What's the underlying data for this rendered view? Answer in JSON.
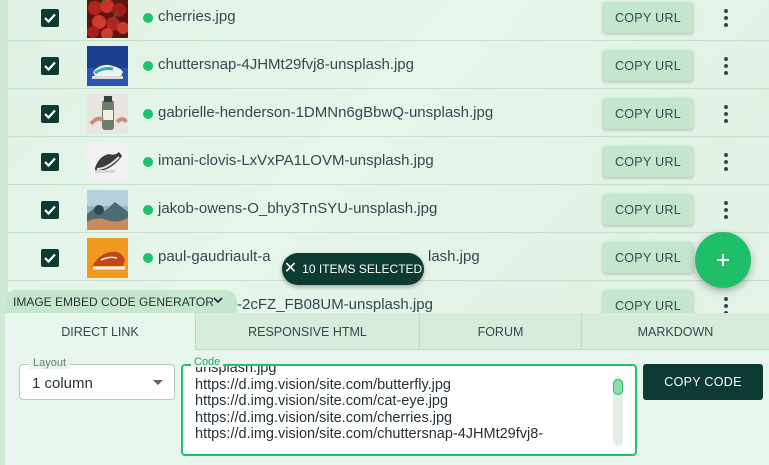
{
  "rows": [
    {
      "filename": "cherries.jpg",
      "checked": true,
      "thumbnail": "cherries-thumbnail",
      "copy_label": "COPY URL"
    },
    {
      "filename": "chuttersnap-4JHMt29fvj8-unsplash.jpg",
      "checked": true,
      "thumbnail": "sneaker-blue-thumbnail",
      "copy_label": "COPY URL"
    },
    {
      "filename": "gabrielle-henderson-1DMNn6gBbwQ-unsplash.jpg",
      "checked": true,
      "thumbnail": "bottle-thumbnail",
      "copy_label": "COPY URL"
    },
    {
      "filename": "imani-clovis-LxVxPA1LOVM-unsplash.jpg",
      "checked": true,
      "thumbnail": "sneaker-white-thumbnail",
      "copy_label": "COPY URL"
    },
    {
      "filename": "jakob-owens-O_bhy3TnSYU-unsplash.jpg",
      "checked": true,
      "thumbnail": "landscape-thumbnail",
      "copy_label": "COPY URL"
    },
    {
      "filename": "paul-gaudriault-a",
      "filename_tail": "lash.jpg",
      "checked": true,
      "thumbnail": "orange-shoe-thumbnail",
      "copy_label": "COPY URL"
    },
    {
      "filename_tail": "-2cFZ_FB08UM-unsplash.jpg",
      "copy_label": "COPY URL"
    }
  ],
  "selection_chip": {
    "label": "10 ITEMS SELECTED"
  },
  "generator": {
    "toggle_label": "IMAGE EMBED CODE GENERATOR"
  },
  "tabs": [
    {
      "label": "DIRECT LINK",
      "active": true
    },
    {
      "label": "RESPONSIVE HTML",
      "active": false
    },
    {
      "label": "FORUM",
      "active": false
    },
    {
      "label": "MARKDOWN",
      "active": false
    }
  ],
  "layout_field": {
    "legend": "Layout",
    "value": "1 column"
  },
  "code_field": {
    "legend": "Code",
    "lines": [
      "unsplash.jpg",
      "https://d.img.vision/site.com/butterfly.jpg",
      "https://d.img.vision/site.com/cat-eye.jpg",
      "https://d.img.vision/site.com/cherries.jpg",
      "https://d.img.vision/site.com/chuttersnap-4JHMt29fvj8-"
    ]
  },
  "copy_code_label": "COPY CODE",
  "colors": {
    "accent": "#21c06b",
    "dark": "#0d3b33",
    "surface": "#e8f5ec"
  },
  "icons": {
    "fab": "plus-icon",
    "chip_close": "close-icon",
    "row_menu": "more-vertical-icon"
  }
}
